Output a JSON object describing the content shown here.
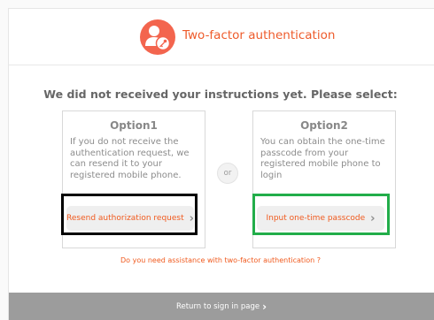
{
  "header": {
    "title": "Two-factor authentication",
    "logo_icon": "user-key-icon",
    "brand_color": "#f3654e"
  },
  "prompt": "We did not received your instructions yet. Please select:",
  "options": [
    {
      "title": "Option1",
      "description": "If you do not receive the authentication request, we can resend it to your registered mobile phone.",
      "button_label": "Resend authorization request"
    },
    {
      "title": "Option2",
      "description": "You can obtain the one-time passcode from your registered mobile phone to login",
      "button_label": "Input one-time passcode"
    }
  ],
  "or_label": "or",
  "help_link": "Do you need assistance with two-factor authentication ?",
  "footer": {
    "return_label": "Return to sign in page"
  },
  "icons": {
    "chevron": "chevron-right-icon"
  },
  "colors": {
    "accent": "#f05a1e",
    "highlight_black": "#000000",
    "highlight_green": "#22ad4a",
    "footer_bg": "#9c9c9c"
  }
}
